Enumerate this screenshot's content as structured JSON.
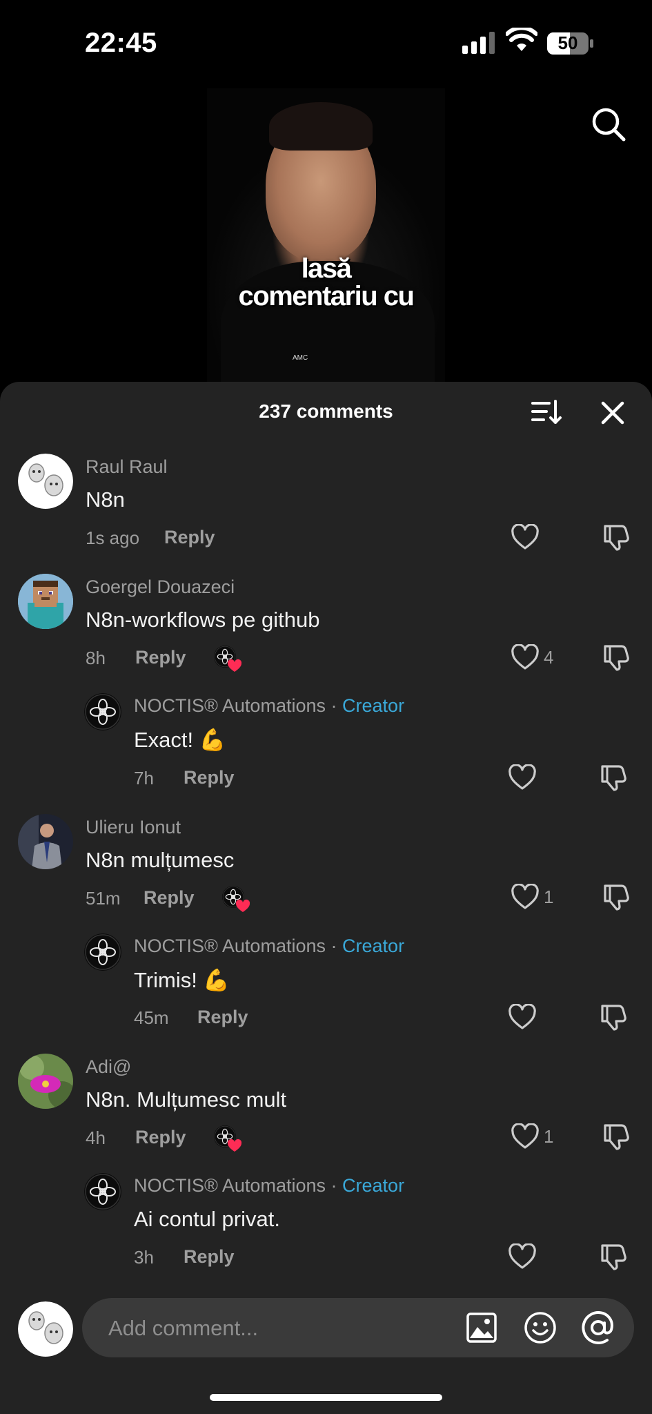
{
  "status": {
    "time": "22:45",
    "battery": "50"
  },
  "video": {
    "caption_line1": "lasă",
    "caption_line2": "comentariu cu",
    "tag": "AMC"
  },
  "sheet": {
    "title": "237 comments"
  },
  "comments": [
    {
      "user": "Raul Raul",
      "text": "N8n",
      "time": "1s ago",
      "reply": "Reply",
      "likes": ""
    },
    {
      "user": "Goergel Douazeci",
      "text": "N8n-workflows pe github",
      "time": "8h",
      "reply": "Reply",
      "likes": "4"
    },
    {
      "user": "NOCTIS® Automations",
      "creator": "Creator",
      "sep": "·",
      "text": "Exact! 💪",
      "time": "7h",
      "reply": "Reply",
      "likes": ""
    },
    {
      "user": "Ulieru Ionut",
      "text": "N8n mulțumesc",
      "time": "51m",
      "reply": "Reply",
      "likes": "1"
    },
    {
      "user": "NOCTIS® Automations",
      "creator": "Creator",
      "sep": "·",
      "text": "Trimis! 💪",
      "time": "45m",
      "reply": "Reply",
      "likes": ""
    },
    {
      "user": "Adi@",
      "text": "N8n. Mulțumesc mult",
      "time": "4h",
      "reply": "Reply",
      "likes": "1"
    },
    {
      "user": "NOCTIS® Automations",
      "creator": "Creator",
      "sep": "·",
      "text": "Ai contul privat.",
      "time": "3h",
      "reply": "Reply",
      "likes": ""
    }
  ],
  "input": {
    "placeholder": "Add comment..."
  },
  "icons": [
    "search-icon",
    "sort-icon",
    "close-icon",
    "heart-icon",
    "dislike-icon",
    "image-icon",
    "emoji-icon",
    "mention-icon"
  ],
  "colors": {
    "sheet_bg": "#232323",
    "creator_blue": "#3aa8d8",
    "like_red": "#fe2c55"
  }
}
